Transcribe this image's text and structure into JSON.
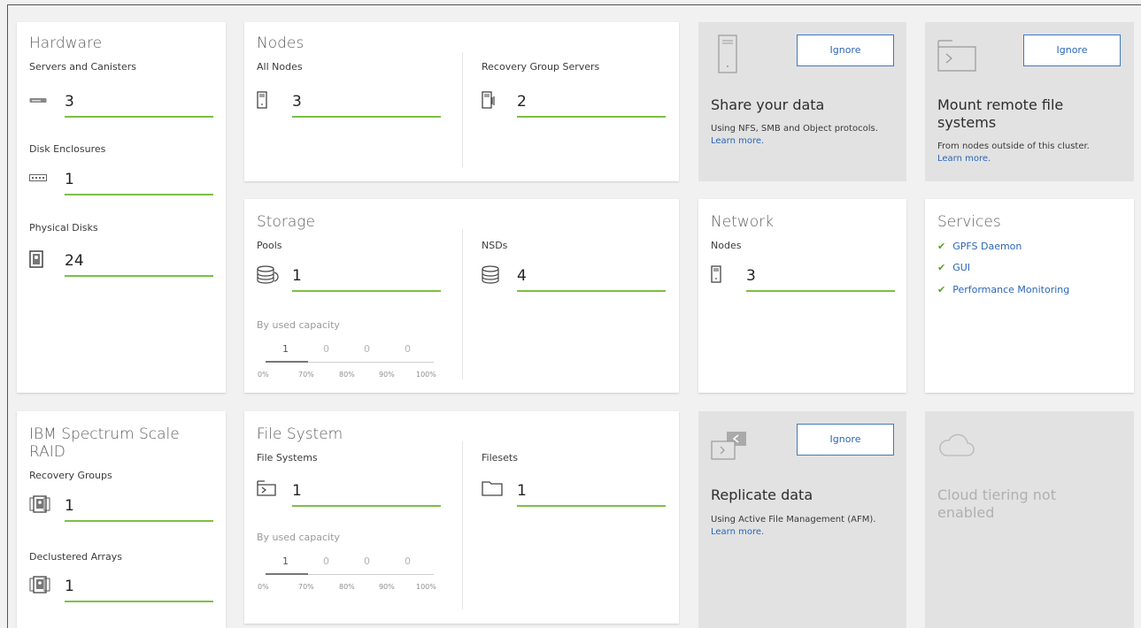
{
  "hardware": {
    "title": "Hardware",
    "servers_label": "Servers and Canisters",
    "servers_value": "3",
    "enclosures_label": "Disk Enclosures",
    "enclosures_value": "1",
    "disks_label": "Physical Disks",
    "disks_value": "24"
  },
  "nodes": {
    "title": "Nodes",
    "all_label": "All Nodes",
    "all_value": "3",
    "rgs_label": "Recovery Group Servers",
    "rgs_value": "2"
  },
  "share": {
    "ignore_label": "Ignore",
    "title": "Share your data",
    "desc": "Using NFS, SMB and Object protocols.",
    "link": "Learn more."
  },
  "mount": {
    "ignore_label": "Ignore",
    "title_line1": "Mount remote file",
    "title_line2": "systems",
    "desc": "From nodes outside of this cluster.",
    "link": "Learn more."
  },
  "storage": {
    "title": "Storage",
    "pools_label": "Pools",
    "pools_value": "1",
    "nsds_label": "NSDs",
    "nsds_value": "4",
    "capacity": {
      "label": "By used capacity",
      "values": [
        "1",
        "0",
        "0",
        "0"
      ],
      "ticks": [
        "0%",
        "70%",
        "80%",
        "90%",
        "100%"
      ]
    }
  },
  "network": {
    "title": "Network",
    "nodes_label": "Nodes",
    "nodes_value": "3"
  },
  "services": {
    "title": "Services",
    "items": [
      "GPFS Daemon",
      "GUI",
      "Performance Monitoring"
    ]
  },
  "raid": {
    "title_line1": "IBM Spectrum Scale",
    "title_line2": "RAID",
    "rg_label": "Recovery Groups",
    "rg_value": "1",
    "da_label": "Declustered Arrays",
    "da_value": "1"
  },
  "filesystem": {
    "title": "File System",
    "fs_label": "File Systems",
    "fs_value": "1",
    "filesets_label": "Filesets",
    "filesets_value": "1",
    "capacity": {
      "label": "By used capacity",
      "values": [
        "1",
        "0",
        "0",
        "0"
      ],
      "ticks": [
        "0%",
        "70%",
        "80%",
        "90%",
        "100%"
      ]
    }
  },
  "replicate": {
    "ignore_label": "Ignore",
    "title": "Replicate data",
    "desc": "Using Active File Management (AFM).",
    "link": "Learn more."
  },
  "cloud": {
    "title_line1": "Cloud tiering not",
    "title_line2": "enabled"
  },
  "colors": {
    "accent_bar": "#7dbf47",
    "link": "#2a66b8",
    "check": "#5aa02c"
  }
}
